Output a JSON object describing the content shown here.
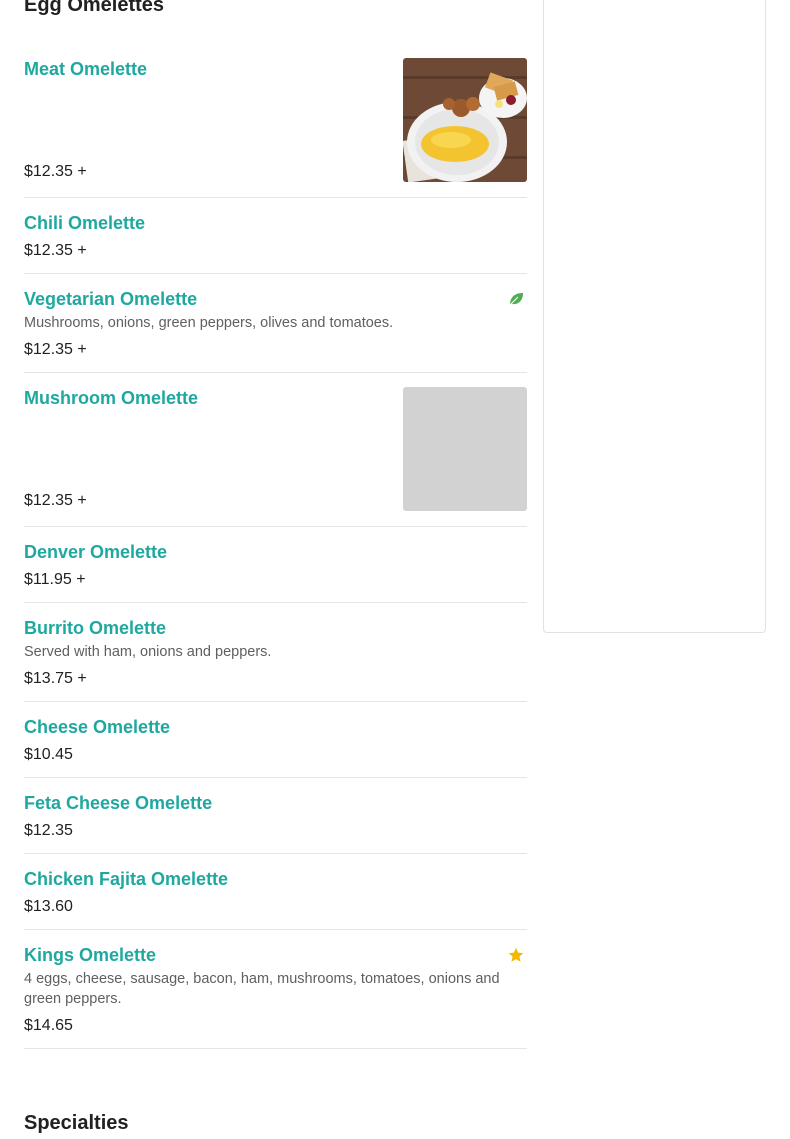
{
  "sections": {
    "egg_omelettes": "Egg Omelettes",
    "specialties": "Specialties"
  },
  "items": [
    {
      "name": "Meat Omelette",
      "price": "$12.35 +"
    },
    {
      "name": "Chili Omelette",
      "price": "$12.35 +"
    },
    {
      "name": "Vegetarian Omelette",
      "description": "Mushrooms, onions, green peppers, olives and tomatoes.",
      "price": "$12.35 +",
      "badge": "leaf-icon"
    },
    {
      "name": "Mushroom Omelette",
      "price": "$12.35 +"
    },
    {
      "name": "Denver Omelette",
      "price": "$11.95 +"
    },
    {
      "name": "Burrito Omelette",
      "description": "Served with ham, onions and peppers.",
      "price": "$13.75 +"
    },
    {
      "name": "Cheese Omelette",
      "price": "$10.45"
    },
    {
      "name": "Feta Cheese Omelette",
      "price": "$12.35"
    },
    {
      "name": "Chicken Fajita Omelette",
      "price": "$13.60"
    },
    {
      "name": "Kings Omelette",
      "description": "4 eggs, cheese, sausage, bacon, ham, mushrooms, tomatoes, onions and green peppers.",
      "price": "$14.65",
      "badge": "star-icon"
    }
  ],
  "colors": {
    "accent": "#1fa8a0",
    "leaf": "#4caf50",
    "star": "#f5b800"
  }
}
